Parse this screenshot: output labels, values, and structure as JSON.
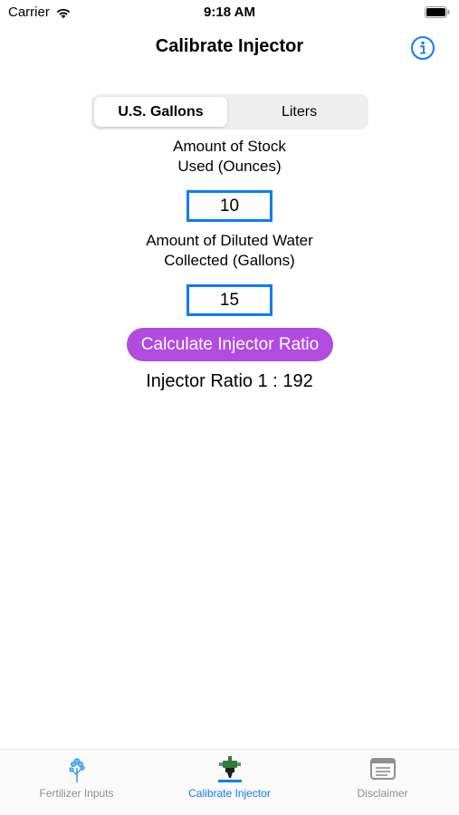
{
  "status_bar": {
    "carrier": "Carrier",
    "time": "9:18 AM"
  },
  "nav": {
    "title": "Calibrate Injector",
    "info_icon": "info-circle-icon"
  },
  "units": {
    "options": [
      "U.S. Gallons",
      "Liters"
    ],
    "selected": "U.S. Gallons"
  },
  "stock": {
    "label_line1": "Amount of Stock",
    "label_line2": "Used (Ounces)",
    "value": "10"
  },
  "water": {
    "label_line1": "Amount of Diluted Water",
    "label_line2": "Collected (Gallons)",
    "value": "15"
  },
  "calculate_label": "Calculate Injector Ratio",
  "result_text": "Injector Ratio 1 : 192",
  "tabs": [
    {
      "label": "Fertilizer Inputs",
      "icon": "flower-icon",
      "active": false
    },
    {
      "label": "Calibrate Injector",
      "icon": "injector-icon",
      "active": true
    },
    {
      "label": "Disclaimer",
      "icon": "document-icon",
      "active": false
    }
  ],
  "colors": {
    "accent": "#0a7bff",
    "button": "#b24be0",
    "inactive_tab": "#8e8e93"
  }
}
